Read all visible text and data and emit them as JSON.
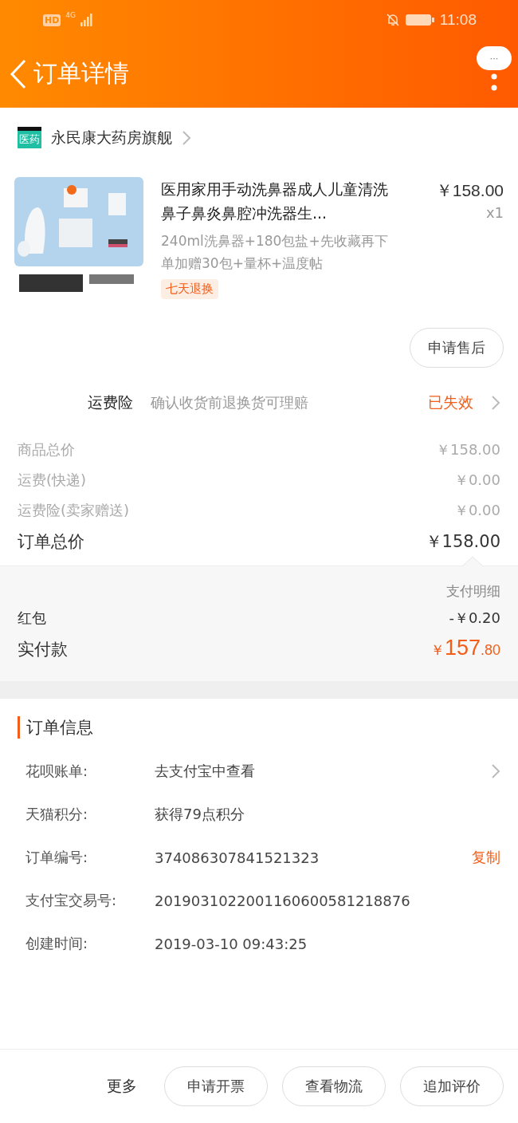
{
  "status_bar": {
    "hd": "HD",
    "network": "4G",
    "time": "11:08"
  },
  "header": {
    "title": "订单详情",
    "menu": "···"
  },
  "shop": {
    "name": "永民康大药房旗舰",
    "badge": "医药"
  },
  "product": {
    "kind": "picture",
    "title": "医用家用手动洗鼻器成人儿童清洗鼻子鼻炎鼻腔冲洗器生...",
    "price": "￥158.00",
    "quantity": "x1",
    "sku": "240ml洗鼻器+180包盐+先收藏再下单加赠30包+量杯+温度帖",
    "tag": "七天退换",
    "action": "申请售后"
  },
  "insurance": {
    "label": "运费险",
    "description": "确认收货前退换货可理赔",
    "status": "已失效"
  },
  "summary": [
    {
      "label": "商品总价",
      "value": "￥158.00",
      "kind": "minor"
    },
    {
      "label": "运费(快递)",
      "value": "￥0.00",
      "kind": "minor"
    },
    {
      "label": "运费险(卖家赠送)",
      "value": "￥0.00",
      "kind": "minor"
    },
    {
      "label": "订单总价",
      "value": "￥158.00",
      "kind": "major"
    }
  ],
  "payment": {
    "detail_label": "支付明细",
    "red_packet_label": "红包",
    "red_packet_value": "-￥0.20",
    "paid_label": "实付款",
    "paid_currency": "￥",
    "paid_integer": "157",
    "paid_decimal": ".80"
  },
  "order_info": {
    "title": "订单信息",
    "rows": [
      {
        "label": "花呗账单:",
        "value": "去支付宝中查看",
        "kind": "link"
      },
      {
        "label": "天猫积分:",
        "value": "获得79点积分",
        "kind": "plain"
      },
      {
        "label": "订单编号:",
        "value": "374086307841521323",
        "kind": "copy",
        "action": "复制"
      },
      {
        "label": "支付宝交易号:",
        "value": "2019031022001160600581218876",
        "kind": "plain"
      },
      {
        "label": "创建时间:",
        "value": "2019-03-10 09:43:25",
        "kind": "plain"
      }
    ]
  },
  "bottom_bar": {
    "more": "更多",
    "buttons": [
      "申请开票",
      "查看物流",
      "追加评价"
    ]
  }
}
